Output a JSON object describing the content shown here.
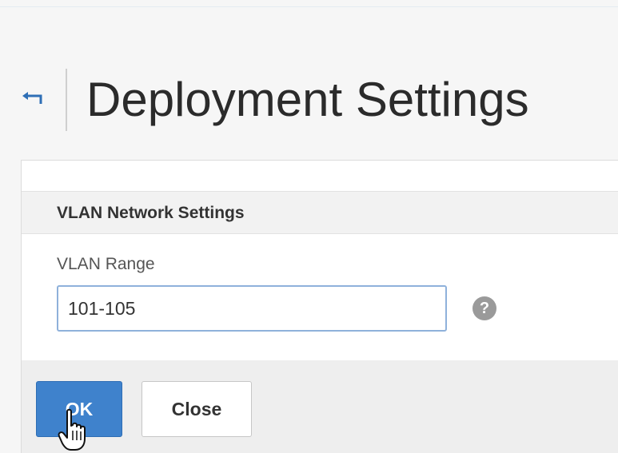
{
  "header": {
    "back_icon": "back-arrow-icon",
    "title": "Deployment Settings"
  },
  "section": {
    "title": "VLAN Network Settings"
  },
  "form": {
    "vlan_range_label": "VLAN Range",
    "vlan_range_value": "101-105",
    "help_glyph": "?"
  },
  "buttons": {
    "ok_label": "OK",
    "close_label": "Close"
  },
  "colors": {
    "accent": "#3f82cc",
    "back_icon": "#2f6fb6"
  }
}
